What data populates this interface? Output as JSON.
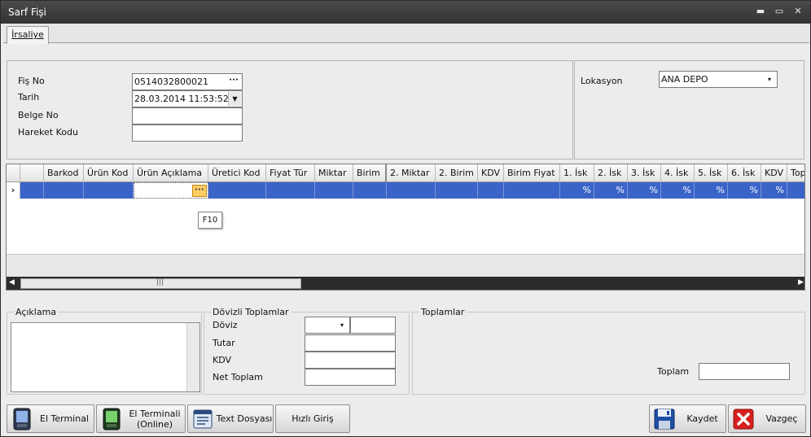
{
  "window": {
    "title": "Sarf Fişi",
    "minimize": "▬",
    "maximize": "▭",
    "close": "✕"
  },
  "tabs": [
    {
      "label": "İrsaliye"
    }
  ],
  "header": {
    "fis_no": {
      "label": "Fiş No",
      "value": "0514032800021",
      "ellipsis": "···"
    },
    "tarih": {
      "label": "Tarih",
      "value": "28.03.2014 11:53:52",
      "arrow": "▼"
    },
    "belge_no": {
      "label": "Belge No",
      "value": ""
    },
    "hareket_kodu": {
      "label": "Hareket Kodu",
      "value": ""
    },
    "lokasyon": {
      "label": "Lokasyon",
      "value": "ANA DEPO",
      "arrow": "▾"
    }
  },
  "grid": {
    "columns": [
      "Barkod",
      "Ürün Kod",
      "Ürün Açıklama",
      "Üretici Kod",
      "Fiyat Tür",
      "Miktar",
      "Birim",
      "2. Miktar",
      "2. Birim",
      "KDV",
      "Birim Fiyat",
      "1. İsk",
      "2. İsk",
      "3. İsk",
      "4. İsk",
      "5. İsk",
      "6. İsk",
      "KDV",
      "Top"
    ],
    "row_indicator": "›",
    "percent": "%",
    "editor_button": "···",
    "tooltip": "F10",
    "scroll_left": "◀",
    "scroll_right": "▶",
    "thumb_grip": "|||"
  },
  "aciklama": {
    "legend": "Açıklama"
  },
  "dovizli": {
    "legend": "Dövizli Toplamlar",
    "doviz": "Döviz",
    "tutar": "Tutar",
    "kdv": "KDV",
    "net_toplam": "Net Toplam",
    "arrow": "▾"
  },
  "toplamlar": {
    "legend": "Toplamlar",
    "toplam": "Toplam"
  },
  "buttons": {
    "el_terminal": "El Terminal",
    "el_terminali_online_1": "El Terminali",
    "el_terminali_online_2": "(Online)",
    "text_dosyasi": "Text Dosyası",
    "hizli_giris": "Hızlı Giriş",
    "kaydet": "Kaydet",
    "vazgec": "Vazgeç"
  },
  "colors": {
    "selection": "#3a64c8",
    "titlebar": "#3d3d3d",
    "accent_button": "#ffcc66"
  }
}
